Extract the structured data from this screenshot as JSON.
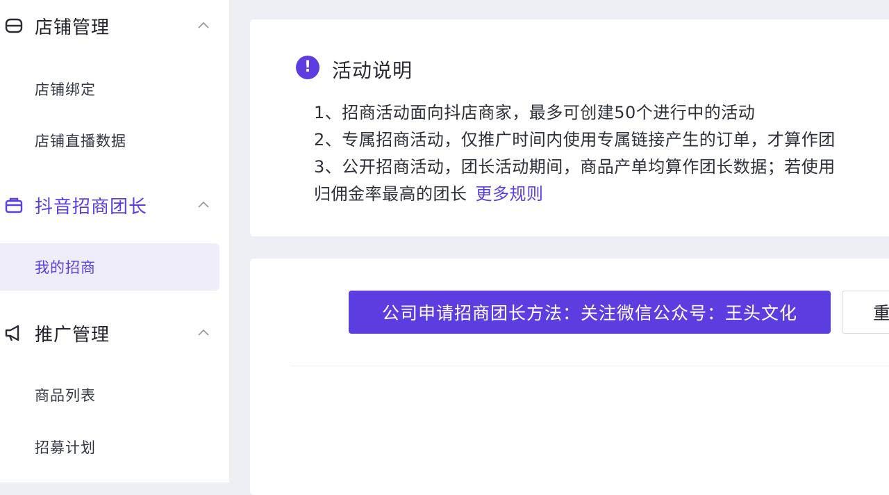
{
  "sidebar": {
    "groups": [
      {
        "title": "店铺管理",
        "icon": "shop-icon",
        "items": [
          "店铺绑定",
          "店铺直播数据"
        ]
      },
      {
        "title": "抖音招商团长",
        "icon": "briefcase-icon",
        "items": [
          "我的招商"
        ]
      },
      {
        "title": "推广管理",
        "icon": "megaphone-icon",
        "items": [
          "商品列表",
          "招募计划"
        ]
      }
    ]
  },
  "notice": {
    "title": "活动说明",
    "lines": [
      "1、招商活动面向抖店商家，最多可创建50个进行中的活动",
      "2、专属招商活动，仅推广时间内使用专属链接产生的订单，才算作团",
      "3、公开招商活动，团长活动期间，商品产单均算作团长数据；若使用",
      "归佣金率最高的团长"
    ],
    "more_link": "更多规则"
  },
  "actions": {
    "primary_label": "公司申请招商团长方法：关注微信公众号：王头文化",
    "reset_label": "重"
  },
  "colors": {
    "accent": "#5b3de0",
    "background": "#eeeff4",
    "selected_bg": "#efedf9"
  }
}
